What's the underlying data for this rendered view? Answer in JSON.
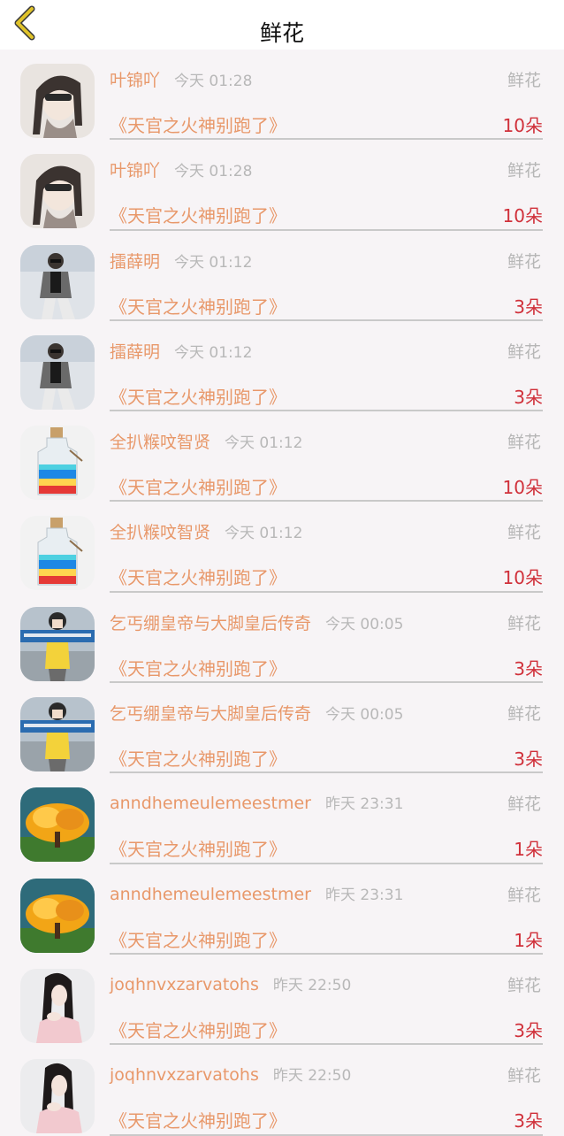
{
  "nav": {
    "title": "鲜花",
    "back_icon": "chevron-left-icon",
    "accent": "#e0c32a"
  },
  "rows": [
    {
      "avatar": "girl-anime",
      "name": "叶锦吖",
      "time": "今天 01:28",
      "type": "鲜花",
      "book": "《天官之火神别跑了》",
      "count": "10朵"
    },
    {
      "avatar": "girl-anime",
      "name": "叶锦吖",
      "time": "今天 01:28",
      "type": "鲜花",
      "book": "《天官之火神别跑了》",
      "count": "10朵"
    },
    {
      "avatar": "boy-cool",
      "name": "擂薛明",
      "time": "今天 01:12",
      "type": "鲜花",
      "book": "《天官之火神别跑了》",
      "count": "3朵"
    },
    {
      "avatar": "boy-cool",
      "name": "擂薛明",
      "time": "今天 01:12",
      "type": "鲜花",
      "book": "《天官之火神别跑了》",
      "count": "3朵"
    },
    {
      "avatar": "bottle",
      "name": "全扒糇呅智贤",
      "time": "今天 01:12",
      "type": "鲜花",
      "book": "《天官之火神别跑了》",
      "count": "10朵"
    },
    {
      "avatar": "bottle",
      "name": "全扒糇呅智贤",
      "time": "今天 01:12",
      "type": "鲜花",
      "book": "《天官之火神别跑了》",
      "count": "10朵"
    },
    {
      "avatar": "girl-street",
      "name": "乞丐绷皇帝与大脚皇后传奇",
      "time": "今天 00:05",
      "type": "鲜花",
      "book": "《天官之火神别跑了》",
      "count": "3朵"
    },
    {
      "avatar": "girl-street",
      "name": "乞丐绷皇帝与大脚皇后传奇",
      "time": "今天 00:05",
      "type": "鲜花",
      "book": "《天官之火神别跑了》",
      "count": "3朵"
    },
    {
      "avatar": "golden-tree",
      "name": "anndhemeulemeestmer",
      "time": "昨天 23:31",
      "type": "鲜花",
      "book": "《天官之火神别跑了》",
      "count": "1朵"
    },
    {
      "avatar": "golden-tree",
      "name": "anndhemeulemeestmer",
      "time": "昨天 23:31",
      "type": "鲜花",
      "book": "《天官之火神别跑了》",
      "count": "1朵"
    },
    {
      "avatar": "girl-pink",
      "name": "joqhnvxzarvatohs",
      "time": "昨天 22:50",
      "type": "鲜花",
      "book": "《天官之火神别跑了》",
      "count": "3朵"
    },
    {
      "avatar": "girl-pink",
      "name": "joqhnvxzarvatohs",
      "time": "昨天 22:50",
      "type": "鲜花",
      "book": "《天官之火神别跑了》",
      "count": "3朵"
    }
  ]
}
